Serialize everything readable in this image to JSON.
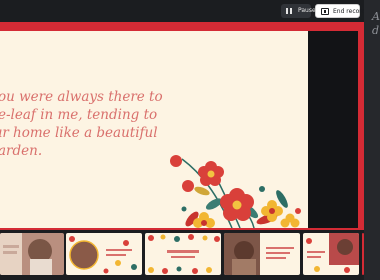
{
  "toolbar": {
    "pause_label": "Pause",
    "end_label": "End recording",
    "pause_icon": "pause-icon",
    "end_icon": "stop-recording-icon"
  },
  "side_note": {
    "text": "A\nd"
  },
  "slide": {
    "lines": [
      "ou were always there to",
      "e-leaf in me, tending to",
      "ır home like a beautiful",
      "arden."
    ],
    "text_color": "#d9706c",
    "background": "#fdf4e3",
    "frame_color": "#d42b35"
  },
  "filmstrip": {
    "thumbnails": [
      {
        "kind": "photo-text"
      },
      {
        "kind": "photo-flowers"
      },
      {
        "kind": "pattern-text"
      },
      {
        "kind": "photo-text"
      },
      {
        "kind": "pattern-text"
      },
      {
        "kind": "photo-text"
      }
    ]
  }
}
